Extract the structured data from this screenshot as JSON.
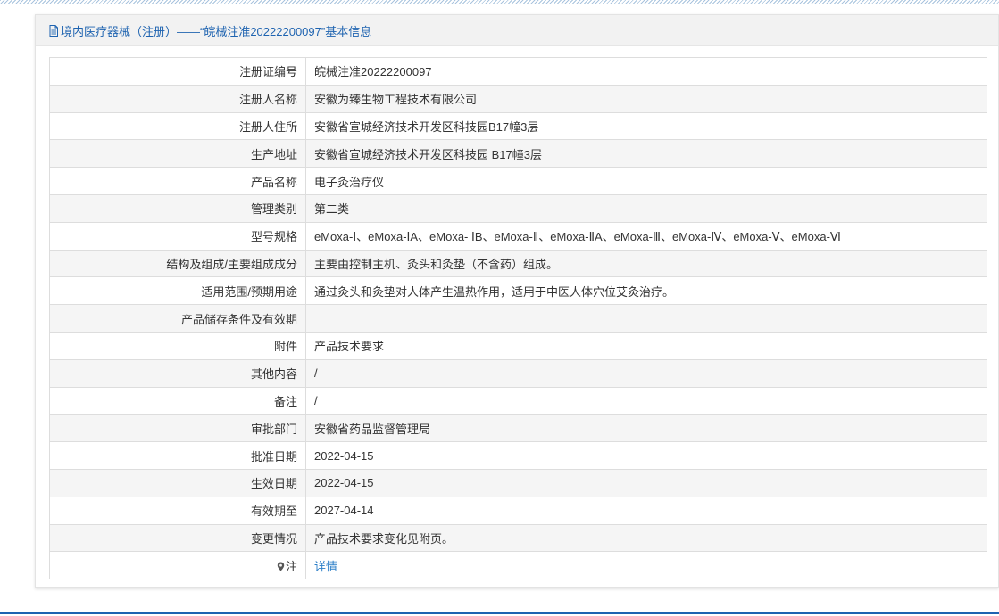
{
  "header": {
    "title": "境内医疗器械（注册）——“皖械注准20222200097”基本信息"
  },
  "rows": [
    {
      "label": "注册证编号",
      "value": "皖械注准20222200097"
    },
    {
      "label": "注册人名称",
      "value": "安徽为臻生物工程技术有限公司"
    },
    {
      "label": "注册人住所",
      "value": "安徽省宣城经济技术开发区科技园B17幢3层"
    },
    {
      "label": "生产地址",
      "value": "安徽省宣城经济技术开发区科技园 B17幢3层"
    },
    {
      "label": "产品名称",
      "value": "电子灸治疗仪"
    },
    {
      "label": "管理类别",
      "value": "第二类"
    },
    {
      "label": "型号规格",
      "value": "eMoxa-Ⅰ、eMoxa-ⅠA、eMoxa- ⅠB、eMoxa-Ⅱ、eMoxa-ⅡA、eMoxa-Ⅲ、eMoxa-Ⅳ、eMoxa-Ⅴ、eMoxa-Ⅵ"
    },
    {
      "label": "结构及组成/主要组成成分",
      "value": "主要由控制主机、灸头和灸垫（不含药）组成。"
    },
    {
      "label": "适用范围/预期用途",
      "value": "通过灸头和灸垫对人体产生温热作用，适用于中医人体穴位艾灸治疗。"
    },
    {
      "label": "产品储存条件及有效期",
      "value": ""
    },
    {
      "label": "附件",
      "value": "产品技术要求"
    },
    {
      "label": "其他内容",
      "value": "/"
    },
    {
      "label": "备注",
      "value": "/"
    },
    {
      "label": "审批部门",
      "value": "安徽省药品监督管理局"
    },
    {
      "label": "批准日期",
      "value": "2022-04-15"
    },
    {
      "label": "生效日期",
      "value": "2022-04-15"
    },
    {
      "label": "有效期至",
      "value": "2027-04-14"
    },
    {
      "label": "变更情况",
      "value": "产品技术要求变化见附页。"
    }
  ],
  "note_row": {
    "label": "注",
    "link_text": "详情",
    "icon": "pin-icon"
  },
  "colors": {
    "title": "#1e63b0",
    "link": "#2d7fc8",
    "header_bg": "#f2f2f2",
    "row_alt_bg": "#f5f5f5",
    "border": "#dddddd"
  }
}
